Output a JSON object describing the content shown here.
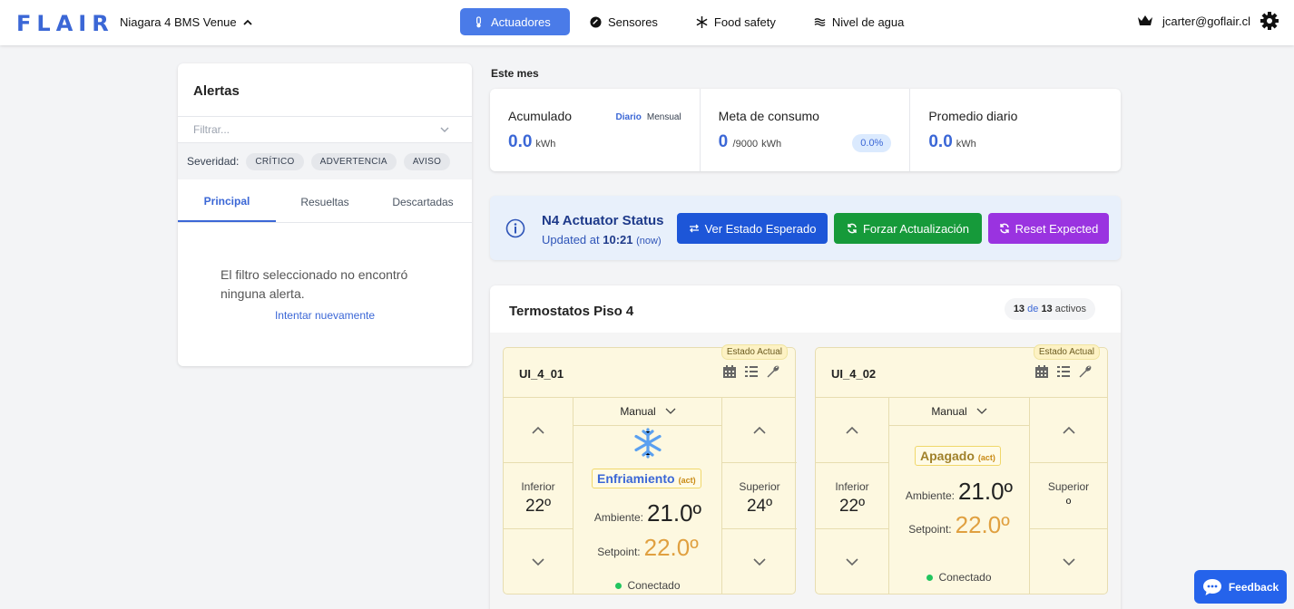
{
  "topbar": {
    "logo": "FLAIR",
    "venue": "Niagara 4 BMS Venue",
    "nav": [
      {
        "label": "Actuadores",
        "icon": "thermometer-icon",
        "active": true
      },
      {
        "label": "Sensores",
        "icon": "gauge-icon",
        "active": false
      },
      {
        "label": "Food safety",
        "icon": "snowflake-icon",
        "active": false
      },
      {
        "label": "Nivel de agua",
        "icon": "water-lines-icon",
        "active": false
      }
    ],
    "user_email": "jcarter@goflair.cl",
    "accent": "#4a7be8"
  },
  "alerts": {
    "title": "Alertas",
    "filter_placeholder": "Filtrar...",
    "severity_label": "Severidad:",
    "severity_chips": [
      "CRÍTICO",
      "ADVERTENCIA",
      "AVISO"
    ],
    "tabs": [
      "Principal",
      "Resueltas",
      "Descartadas"
    ],
    "empty_message": "El filtro seleccionado no encontró ninguna alerta.",
    "retry": "Intentar nuevamente"
  },
  "month": {
    "label": "Este mes",
    "accumulated": {
      "title": "Acumulado",
      "value": "0.0",
      "unit": "kWh",
      "toggle_on": "Diario",
      "toggle_off": "Mensual"
    },
    "goal": {
      "title": "Meta de consumo",
      "value": "0",
      "sub": "/9000",
      "unit": "kWh",
      "percent": "0.0%"
    },
    "average": {
      "title": "Promedio diario",
      "value": "0.0",
      "unit": "kWh"
    }
  },
  "status": {
    "title": "N4 Actuator Status",
    "updated_prefix": "Updated at",
    "time": "10:21",
    "relative": "(now)",
    "buttons": {
      "expected": "Ver Estado Esperado",
      "force": "Forzar Actualización",
      "reset": "Reset Expected"
    }
  },
  "thermostats": {
    "title": "Termostatos Piso 4",
    "active_count": "13",
    "of": "de",
    "total": "13",
    "active_label": "activos",
    "cards": [
      {
        "name": "UI_4_01",
        "badge": "Estado Actual",
        "mode": "Manual",
        "lower_label": "Inferior",
        "lower_value": "22º",
        "upper_label": "Superior",
        "upper_value": "24º",
        "state": "Enfriamiento",
        "state_tag": "(act)",
        "ambient_label": "Ambiente:",
        "ambient": "21.0º",
        "setpoint_label": "Setpoint:",
        "setpoint": "22.0º",
        "connection": "Conectado"
      },
      {
        "name": "UI_4_02",
        "badge": "Estado Actual",
        "mode": "Manual",
        "lower_label": "Inferior",
        "lower_value": "22º",
        "upper_label": "Superior",
        "upper_value": "º",
        "state": "Apagado",
        "state_tag": "(act)",
        "ambient_label": "Ambiente:",
        "ambient": "21.0º",
        "setpoint_label": "Setpoint:",
        "setpoint": "22.0º",
        "connection": "Conectado"
      }
    ]
  },
  "feedback": "Feedback"
}
